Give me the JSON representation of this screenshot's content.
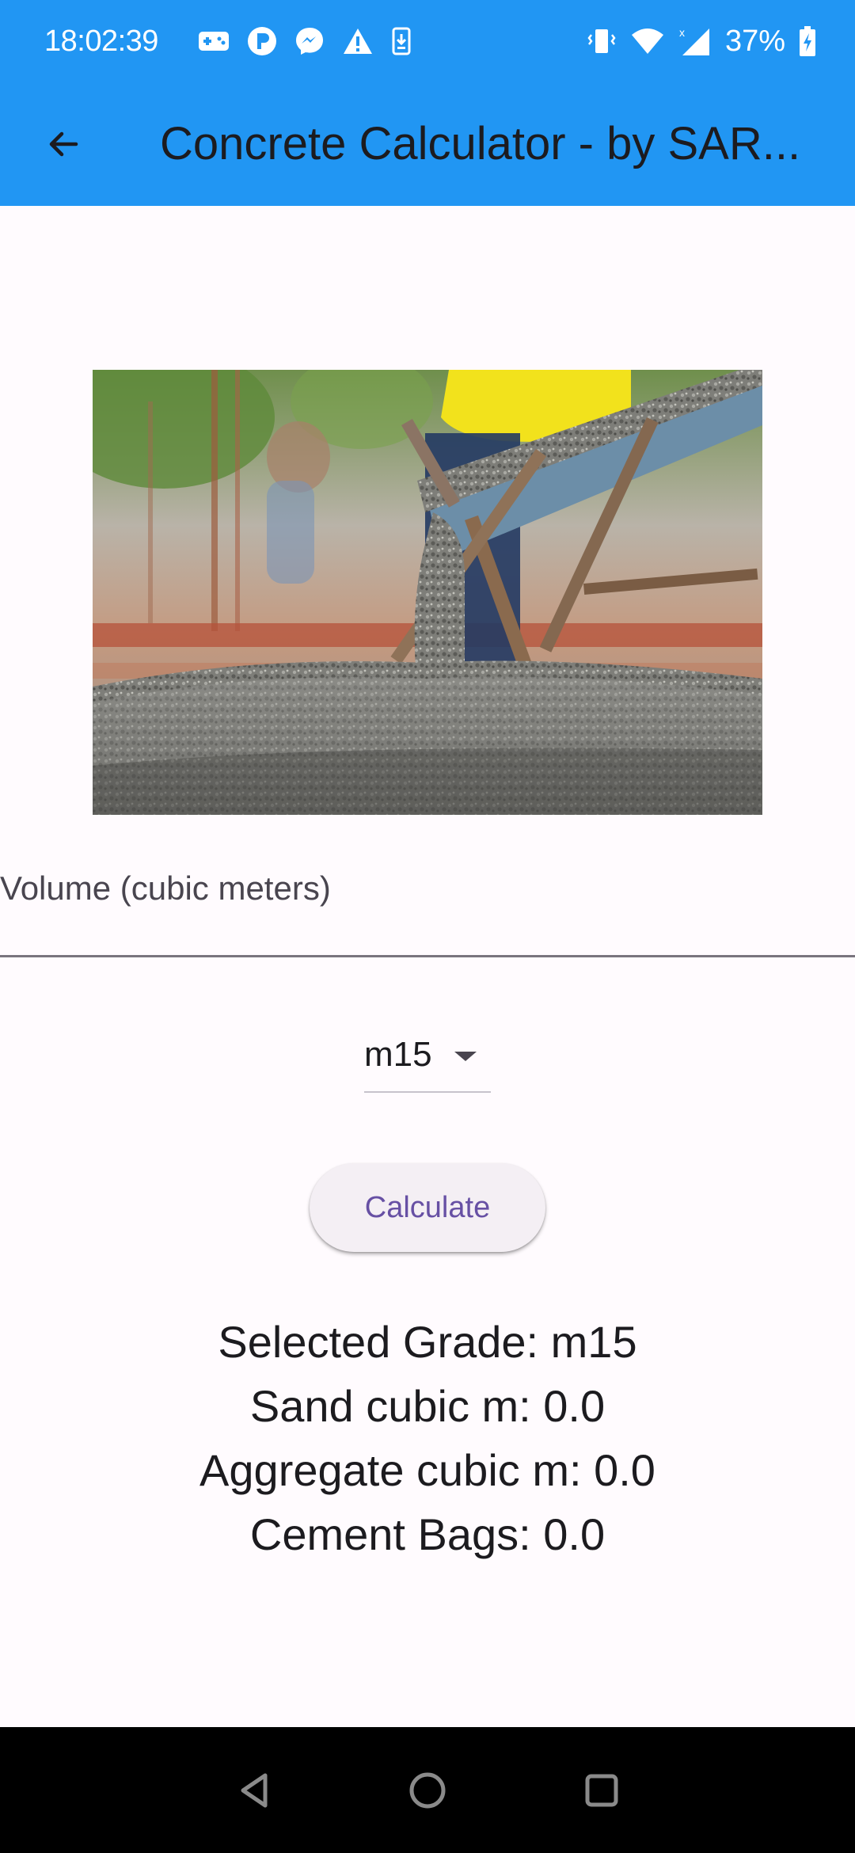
{
  "status_bar": {
    "time": "18:02:39",
    "battery_percent": "37%",
    "background_color": "#2196f3",
    "left_icons": [
      "gamepad-icon",
      "p-app-icon",
      "messenger-icon",
      "warning-icon",
      "download-icon"
    ],
    "right_icons": [
      "vibrate-icon",
      "wifi-icon",
      "signal-icon",
      "battery-charging-icon"
    ]
  },
  "app_bar": {
    "title": "Concrete Calculator - by SAR...",
    "back_icon": "arrow-back-icon",
    "background_color": "#2196f3"
  },
  "hero_image": {
    "subject": "concrete pouring from chute photo"
  },
  "form": {
    "volume_placeholder": "Volume (cubic meters)",
    "volume_value": "",
    "grade_selected": "m15",
    "calculate_label": "Calculate",
    "accent_color": "#6750a4"
  },
  "results": {
    "selected_grade": "Selected Grade: m15",
    "sand": "Sand cubic m: 0.0",
    "aggregate": "Aggregate cubic m: 0.0",
    "cement": "Cement Bags: 0.0"
  },
  "nav_bar": {
    "icons": [
      "back-triangle-icon",
      "home-circle-icon",
      "recents-square-icon"
    ]
  }
}
